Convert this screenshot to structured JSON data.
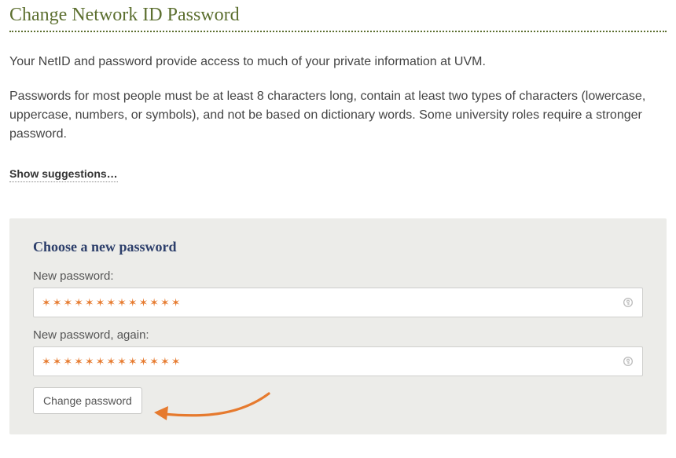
{
  "title": "Change Network ID Password",
  "intro1": "Your NetID and password provide access to much of your private information at UVM.",
  "intro2": "Passwords for most people must be at least 8 characters long, contain at least two types of characters (lowercase, uppercase, numbers, or symbols), and not be based on dictionary words. Some university roles require a stronger password.",
  "show_suggestions_label": "Show suggestions…",
  "panel": {
    "title": "Choose a new password",
    "new_pw_label": "New password:",
    "new_pw_again_label": "New password, again:",
    "mask": "✶✶✶✶✶✶✶✶✶✶✶✶✶",
    "change_btn": "Change password"
  }
}
